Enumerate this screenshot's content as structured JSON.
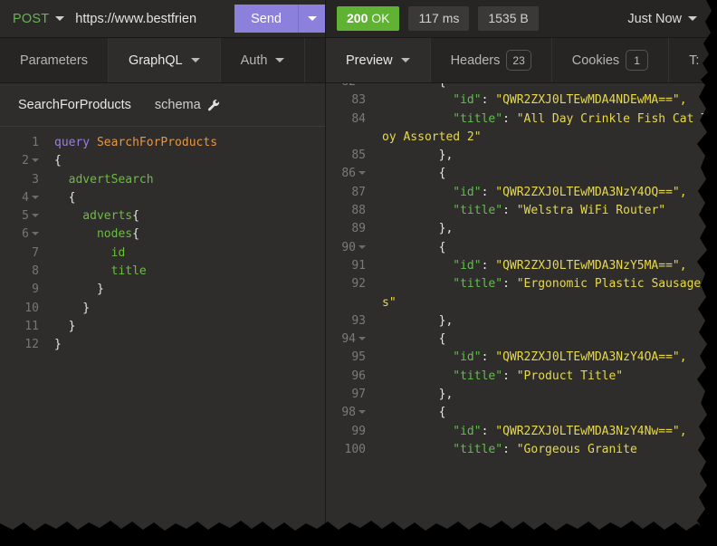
{
  "request_bar": {
    "method": "POST",
    "method_icon": "chevron-down-icon",
    "url": "https://www.bestfrien",
    "send_label": "Send",
    "send_dropdown_icon": "chevron-down-icon"
  },
  "response_status": {
    "code": "200",
    "code_text": "OK",
    "time": "117 ms",
    "size": "1535 B",
    "timestamp": "Just Now",
    "timestamp_icon": "chevron-down-icon",
    "status_color": "#60b233"
  },
  "request_tabs": [
    {
      "label": "Parameters",
      "active": false,
      "caret": false
    },
    {
      "label": "GraphQL",
      "active": true,
      "caret": true
    },
    {
      "label": "Auth",
      "active": false,
      "caret": true
    }
  ],
  "response_tabs": [
    {
      "label": "Preview",
      "active": true,
      "caret": true,
      "badge": ""
    },
    {
      "label": "Headers",
      "active": false,
      "caret": false,
      "badge": "23"
    },
    {
      "label": "Cookies",
      "active": false,
      "caret": false,
      "badge": "1"
    },
    {
      "label": "T:",
      "active": false,
      "caret": false,
      "badge": ""
    }
  ],
  "editor_header": {
    "operation_name": "SearchForProducts",
    "schema_label": "schema",
    "schema_icon": "wrench-icon"
  },
  "query_editor": {
    "lines": [
      {
        "n": "1",
        "fold": false,
        "tokens": [
          {
            "t": "kw",
            "v": "query "
          },
          {
            "t": "name",
            "v": "SearchForProducts"
          }
        ]
      },
      {
        "n": "2",
        "fold": true,
        "tokens": [
          {
            "t": "pun",
            "v": "{"
          }
        ]
      },
      {
        "n": "3",
        "fold": false,
        "tokens": [
          {
            "t": "fld",
            "v": "  advertSearch"
          }
        ]
      },
      {
        "n": "4",
        "fold": true,
        "tokens": [
          {
            "t": "pun",
            "v": "  {"
          }
        ]
      },
      {
        "n": "5",
        "fold": true,
        "tokens": [
          {
            "t": "fld",
            "v": "    adverts"
          },
          {
            "t": "pun",
            "v": "{"
          }
        ]
      },
      {
        "n": "6",
        "fold": true,
        "tokens": [
          {
            "t": "fld",
            "v": "      nodes"
          },
          {
            "t": "pun",
            "v": "{"
          }
        ]
      },
      {
        "n": "7",
        "fold": false,
        "tokens": [
          {
            "t": "fld",
            "v": "        id"
          }
        ]
      },
      {
        "n": "8",
        "fold": false,
        "tokens": [
          {
            "t": "fld",
            "v": "        title"
          }
        ]
      },
      {
        "n": "9",
        "fold": false,
        "tokens": [
          {
            "t": "pun",
            "v": "      }"
          }
        ]
      },
      {
        "n": "10",
        "fold": false,
        "tokens": [
          {
            "t": "pun",
            "v": "    }"
          }
        ]
      },
      {
        "n": "11",
        "fold": false,
        "tokens": [
          {
            "t": "pun",
            "v": "  }"
          }
        ]
      },
      {
        "n": "12",
        "fold": false,
        "tokens": [
          {
            "t": "pun",
            "v": "}"
          }
        ]
      }
    ]
  },
  "response_body": {
    "lines": [
      {
        "n": "82",
        "fold": true,
        "tokens": [
          {
            "t": "pun",
            "v": "        {"
          }
        ]
      },
      {
        "n": "83",
        "fold": false,
        "tokens": [
          {
            "t": "key",
            "v": "          \"id\""
          },
          {
            "t": "pun",
            "v": ": "
          },
          {
            "t": "str",
            "v": "\"QWR2ZXJ0LTEwMDA4NDEwMA==\","
          }
        ]
      },
      {
        "n": "84",
        "fold": false,
        "tokens": [
          {
            "t": "key",
            "v": "          \"title\""
          },
          {
            "t": "pun",
            "v": ": "
          },
          {
            "t": "str",
            "v": "\"All Day Crinkle Fish Cat Toy Assorted 2\""
          }
        ]
      },
      {
        "n": "85",
        "fold": false,
        "tokens": [
          {
            "t": "pun",
            "v": "        },"
          }
        ]
      },
      {
        "n": "86",
        "fold": true,
        "tokens": [
          {
            "t": "pun",
            "v": "        {"
          }
        ]
      },
      {
        "n": "87",
        "fold": false,
        "tokens": [
          {
            "t": "key",
            "v": "          \"id\""
          },
          {
            "t": "pun",
            "v": ": "
          },
          {
            "t": "str",
            "v": "\"QWR2ZXJ0LTEwMDA3NzY4OQ==\","
          }
        ]
      },
      {
        "n": "88",
        "fold": false,
        "tokens": [
          {
            "t": "key",
            "v": "          \"title\""
          },
          {
            "t": "pun",
            "v": ": "
          },
          {
            "t": "str",
            "v": "\"Welstra WiFi Router\""
          }
        ]
      },
      {
        "n": "89",
        "fold": false,
        "tokens": [
          {
            "t": "pun",
            "v": "        },"
          }
        ]
      },
      {
        "n": "90",
        "fold": true,
        "tokens": [
          {
            "t": "pun",
            "v": "        {"
          }
        ]
      },
      {
        "n": "91",
        "fold": false,
        "tokens": [
          {
            "t": "key",
            "v": "          \"id\""
          },
          {
            "t": "pun",
            "v": ": "
          },
          {
            "t": "str",
            "v": "\"QWR2ZXJ0LTEwMDA3NzY5MA==\","
          }
        ]
      },
      {
        "n": "92",
        "fold": false,
        "tokens": [
          {
            "t": "key",
            "v": "          \"title\""
          },
          {
            "t": "pun",
            "v": ": "
          },
          {
            "t": "str",
            "v": "\"Ergonomic Plastic Sausages\""
          }
        ]
      },
      {
        "n": "93",
        "fold": false,
        "tokens": [
          {
            "t": "pun",
            "v": "        },"
          }
        ]
      },
      {
        "n": "94",
        "fold": true,
        "tokens": [
          {
            "t": "pun",
            "v": "        {"
          }
        ]
      },
      {
        "n": "95",
        "fold": false,
        "tokens": [
          {
            "t": "key",
            "v": "          \"id\""
          },
          {
            "t": "pun",
            "v": ": "
          },
          {
            "t": "str",
            "v": "\"QWR2ZXJ0LTEwMDA3NzY4OA==\","
          }
        ]
      },
      {
        "n": "96",
        "fold": false,
        "tokens": [
          {
            "t": "key",
            "v": "          \"title\""
          },
          {
            "t": "pun",
            "v": ": "
          },
          {
            "t": "str",
            "v": "\"Product Title\""
          }
        ]
      },
      {
        "n": "97",
        "fold": false,
        "tokens": [
          {
            "t": "pun",
            "v": "        },"
          }
        ]
      },
      {
        "n": "98",
        "fold": true,
        "tokens": [
          {
            "t": "pun",
            "v": "        {"
          }
        ]
      },
      {
        "n": "99",
        "fold": false,
        "tokens": [
          {
            "t": "key",
            "v": "          \"id\""
          },
          {
            "t": "pun",
            "v": ": "
          },
          {
            "t": "str",
            "v": "\"QWR2ZXJ0LTEwMDA3NzY4Nw==\","
          }
        ]
      },
      {
        "n": "100",
        "fold": false,
        "tokens": [
          {
            "t": "key",
            "v": "          \"title\""
          },
          {
            "t": "pun",
            "v": ": "
          },
          {
            "t": "str",
            "v": "\"Gorgeous Granite"
          }
        ]
      }
    ]
  }
}
